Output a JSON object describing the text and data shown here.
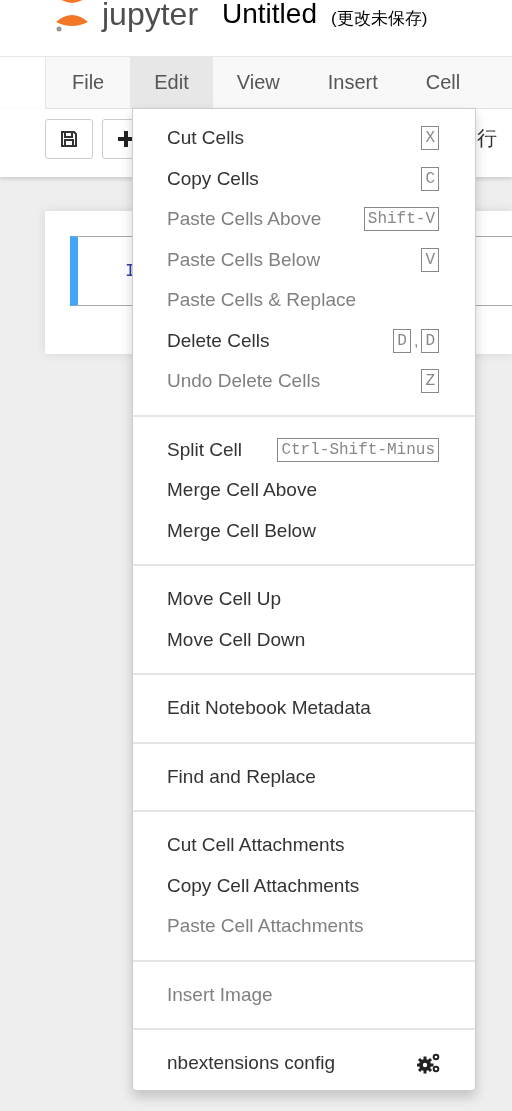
{
  "header": {
    "logo_text": "jupyter",
    "notebook_name": "Untitled",
    "save_status": "(更改未保存)"
  },
  "menubar": [
    {
      "label": "File",
      "selected": false
    },
    {
      "label": "Edit",
      "selected": true
    },
    {
      "label": "View",
      "selected": false
    },
    {
      "label": "Insert",
      "selected": false
    },
    {
      "label": "Cell",
      "selected": false
    }
  ],
  "toolbar": {
    "text": "行"
  },
  "cell": {
    "prompt": "I",
    "selected": true
  },
  "menu": {
    "groups": [
      [
        {
          "kind": "command",
          "label": "Cut Cells",
          "disabled": false,
          "keys": [
            "X"
          ]
        },
        {
          "kind": "command",
          "label": "Copy Cells",
          "disabled": false,
          "keys": [
            "C"
          ]
        },
        {
          "kind": "command",
          "label": "Paste Cells Above",
          "disabled": true,
          "keys": [
            "Shift-V"
          ]
        },
        {
          "kind": "command",
          "label": "Paste Cells Below",
          "disabled": true,
          "keys": [
            "V"
          ]
        },
        {
          "kind": "command",
          "label": "Paste Cells & Replace",
          "disabled": true
        },
        {
          "kind": "command",
          "label": "Delete Cells",
          "disabled": false,
          "keys": [
            "D",
            "D"
          ],
          "separator": ","
        },
        {
          "kind": "command",
          "label": "Undo Delete Cells",
          "disabled": true,
          "keys": [
            "Z"
          ]
        }
      ],
      [
        {
          "kind": "command",
          "label": "Split Cell",
          "disabled": false,
          "keys": [
            "Ctrl-Shift-Minus"
          ]
        },
        {
          "kind": "command",
          "label": "Merge Cell Above",
          "disabled": false
        },
        {
          "kind": "command",
          "label": "Merge Cell Below",
          "disabled": false
        }
      ],
      [
        {
          "kind": "command",
          "label": "Move Cell Up",
          "disabled": false
        },
        {
          "kind": "command",
          "label": "Move Cell Down",
          "disabled": false
        }
      ],
      [
        {
          "kind": "command",
          "label": "Edit Notebook Metadata",
          "disabled": false
        }
      ],
      [
        {
          "kind": "command",
          "label": "Find and Replace",
          "disabled": false
        }
      ],
      [
        {
          "kind": "command",
          "label": "Cut Cell Attachments",
          "disabled": false
        },
        {
          "kind": "command",
          "label": "Copy Cell Attachments",
          "disabled": false
        },
        {
          "kind": "command",
          "label": "Paste Cell Attachments",
          "disabled": true
        }
      ],
      [
        {
          "kind": "command",
          "label": "Insert Image",
          "disabled": true
        }
      ],
      [
        {
          "kind": "config",
          "label": "nbextensions config",
          "disabled": false
        }
      ]
    ]
  }
}
